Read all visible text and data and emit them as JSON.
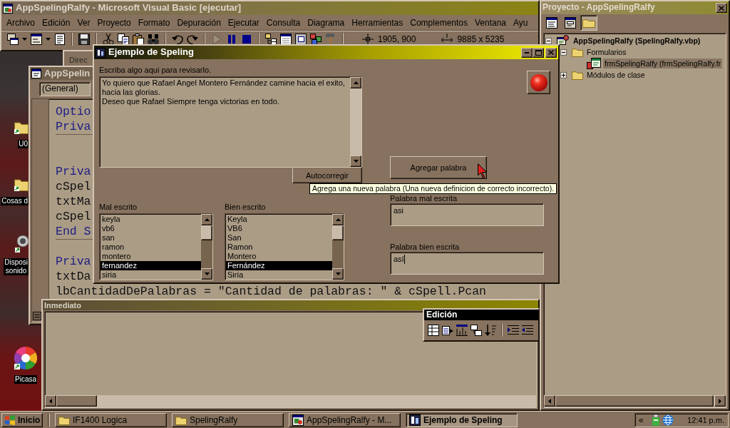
{
  "desktop": {
    "icons": [
      {
        "kind": "folder",
        "lines": [
          "U0"
        ]
      },
      {
        "kind": "folder",
        "lines": [
          "Cosas d"
        ]
      },
      {
        "kind": "speaker",
        "lines": [
          "Disposi",
          "sonido"
        ]
      },
      {
        "kind": "pinwheel",
        "lines": [
          "Picasa"
        ]
      }
    ]
  },
  "vb_window": {
    "title": "AppSpelingRalfy - Microsoft Visual Basic [ejecutar]",
    "menu": [
      "Archivo",
      "Edición",
      "Ver",
      "Proyecto",
      "Formato",
      "Depuración",
      "Ejecutar",
      "Consulta",
      "Diagrama",
      "Herramientas",
      "Complementos",
      "Ventana",
      "Ayu"
    ],
    "position": "1905, 900",
    "size": "9885 x 5235"
  },
  "back_window": {
    "text": "Direc"
  },
  "code_window": {
    "title": "AppSpelin",
    "object": "(General)",
    "blocks": [
      [
        {
          "kind": "keyword",
          "text": "Optio"
        },
        {
          "kind": "keyword",
          "text": "Priva"
        }
      ],
      [
        {
          "kind": "keyword",
          "text": "Priva"
        },
        {
          "kind": "plain",
          "text": "cSpel"
        },
        {
          "kind": "plain",
          "text": "txtMa"
        },
        {
          "kind": "plain",
          "text": "cSpel"
        },
        {
          "kind": "keyword",
          "text": "End S"
        }
      ],
      [
        {
          "kind": "keyword",
          "text": "Priva"
        },
        {
          "kind": "plain",
          "text": "txtDa"
        },
        {
          "kind": "plain",
          "text": "lbCantidadDePalabras = \"Cantidad de palabras: \" & cSpell.Pcan"
        }
      ]
    ]
  },
  "immediate_window": {
    "title": "Inmediato"
  },
  "edit_toolbar": {
    "title": "Edición"
  },
  "project_window": {
    "title": "Proyecto - AppSpelingRalfy",
    "toolbar": [
      {
        "kind": "code",
        "pressed": false
      },
      {
        "kind": "form",
        "pressed": false
      },
      {
        "kind": "folders",
        "pressed": true
      }
    ],
    "tree": [
      {
        "kind": "project",
        "label": "AppSpelingRalfy (SpelingRalfy.vbp)",
        "expanded": true,
        "selected": false,
        "children": [
          {
            "kind": "folder",
            "label": "Formularios",
            "expanded": true,
            "selected": false,
            "children": [
              {
                "kind": "form",
                "label": "frmSpelingRalfy (frmSpelingRalfy.fr",
                "selected": true
              }
            ]
          },
          {
            "kind": "folder",
            "label": "Módulos de clase",
            "expanded": false,
            "selected": false
          }
        ]
      }
    ]
  },
  "dialog": {
    "title": "Ejemplo de Speling",
    "prompt": "Escriba algo aqui para revisarlo.",
    "text": "Yo quiero que Rafael Angel Montero Fernández camine hacia el exito,\nhacia las glorias.\nDeseo que Rafael Siempre tenga victorias en todo.",
    "autocorrect": "Autocorregir",
    "add_word": "Agregar palabra",
    "lists": [
      {
        "label": "Mal escrito",
        "items": [
          {
            "text": "keyla",
            "selected": false
          },
          {
            "text": "vb6",
            "selected": false
          },
          {
            "text": "san",
            "selected": false
          },
          {
            "text": "ramon",
            "selected": false
          },
          {
            "text": "montero",
            "selected": false
          },
          {
            "text": "fernandez",
            "selected": true
          },
          {
            "text": "siria",
            "selected": false
          }
        ]
      },
      {
        "label": "Bien escrito",
        "items": [
          {
            "text": "Keyla",
            "selected": false
          },
          {
            "text": "VB6",
            "selected": false
          },
          {
            "text": "San",
            "selected": false
          },
          {
            "text": "Ramon",
            "selected": false
          },
          {
            "text": "Montero",
            "selected": false
          },
          {
            "text": "Fernández",
            "selected": true
          },
          {
            "text": "Siria",
            "selected": false
          }
        ]
      }
    ],
    "fields": [
      {
        "label": "Palabra mal escrita",
        "value": "asi",
        "focused": false
      },
      {
        "label": "Palabra bien escrita",
        "value": "así",
        "focused": true
      }
    ]
  },
  "tooltip": "Agrega una nueva palabra (Una nueva definicion de correcto incorrecto).",
  "taskbar": {
    "start": "Inicio",
    "tasks": [
      {
        "kind": "folder",
        "label": "IF1400 Logica",
        "selected": false
      },
      {
        "kind": "folder",
        "label": "SpelingRalfy",
        "selected": false
      },
      {
        "kind": "vb",
        "label": "AppSpelingRalfy - M...",
        "selected": false
      },
      {
        "kind": "app",
        "label": "Ejemplo de Speling",
        "selected": true
      }
    ],
    "tray_toggle": "«",
    "clock": "12:41 p.m."
  }
}
